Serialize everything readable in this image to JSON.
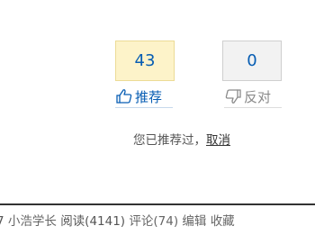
{
  "vote": {
    "digg_count": "43",
    "bury_count": "0",
    "digg_label": "推荐",
    "bury_label": "反对",
    "feedback_text": "您已推荐过，",
    "cancel_label": "取消"
  },
  "post_info": {
    "time_fragment": "7",
    "author": "小浩学长",
    "views": "阅读(4141)",
    "comments": "评论(74)",
    "edit": "编辑",
    "collect": "收藏"
  },
  "colors": {
    "accent": "#075db3",
    "digg_bg": "#fdf3c9",
    "bury_bg": "#f2f2f2"
  },
  "icons": {
    "digg": "thumbs-up-icon",
    "bury": "thumbs-down-icon"
  }
}
